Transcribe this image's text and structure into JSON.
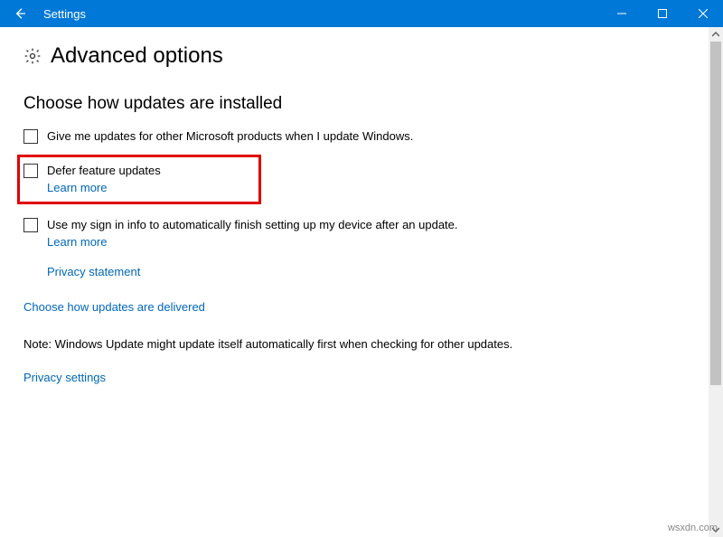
{
  "titlebar": {
    "title": "Settings"
  },
  "page": {
    "heading": "Advanced options"
  },
  "section": {
    "heading": "Choose how updates are installed",
    "options": [
      {
        "label": "Give me updates for other Microsoft products when I update Windows."
      },
      {
        "label": "Defer feature updates",
        "learn_more": "Learn more"
      },
      {
        "label": "Use my sign in info to automatically finish setting up my device after an update.",
        "learn_more": "Learn more"
      }
    ],
    "privacy_statement": "Privacy statement",
    "delivered_link": "Choose how updates are delivered",
    "note": "Note: Windows Update might update itself automatically first when checking for other updates.",
    "privacy_settings": "Privacy settings"
  },
  "watermark": "wsxdn.com"
}
